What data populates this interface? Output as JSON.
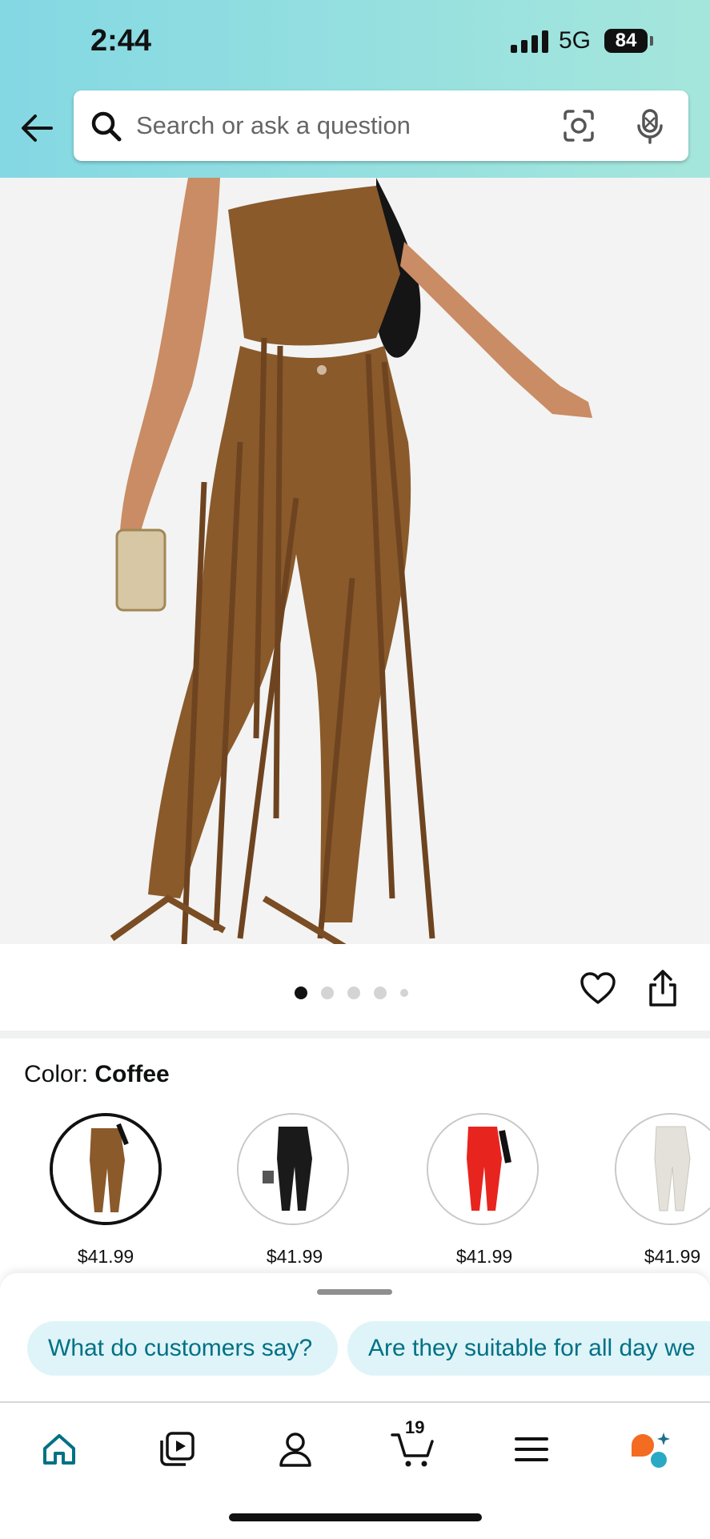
{
  "status_bar": {
    "time": "2:44",
    "network": "5G",
    "battery": "84"
  },
  "search": {
    "placeholder": "Search or ask a question"
  },
  "product_gallery": {
    "image_count": 5,
    "active_index": 0
  },
  "color_selector": {
    "label": "Color:",
    "selected": "Coffee",
    "options": [
      {
        "color": "#8a5a2b",
        "price": "$41.99"
      },
      {
        "color": "#1a1a1a",
        "price": "$41.99"
      },
      {
        "color": "#e8241f",
        "price": "$41.99"
      },
      {
        "color": "#ecebe6",
        "price": "$41.99"
      }
    ]
  },
  "ask_sheet": {
    "chips": [
      "What do customers say?",
      "Are they suitable for all day we"
    ]
  },
  "bottom_nav": {
    "items": [
      "home-icon",
      "video-icon",
      "account-icon",
      "cart-icon",
      "menu-icon",
      "rufus-icon"
    ],
    "cart_count": "19",
    "accent": "#007185"
  }
}
